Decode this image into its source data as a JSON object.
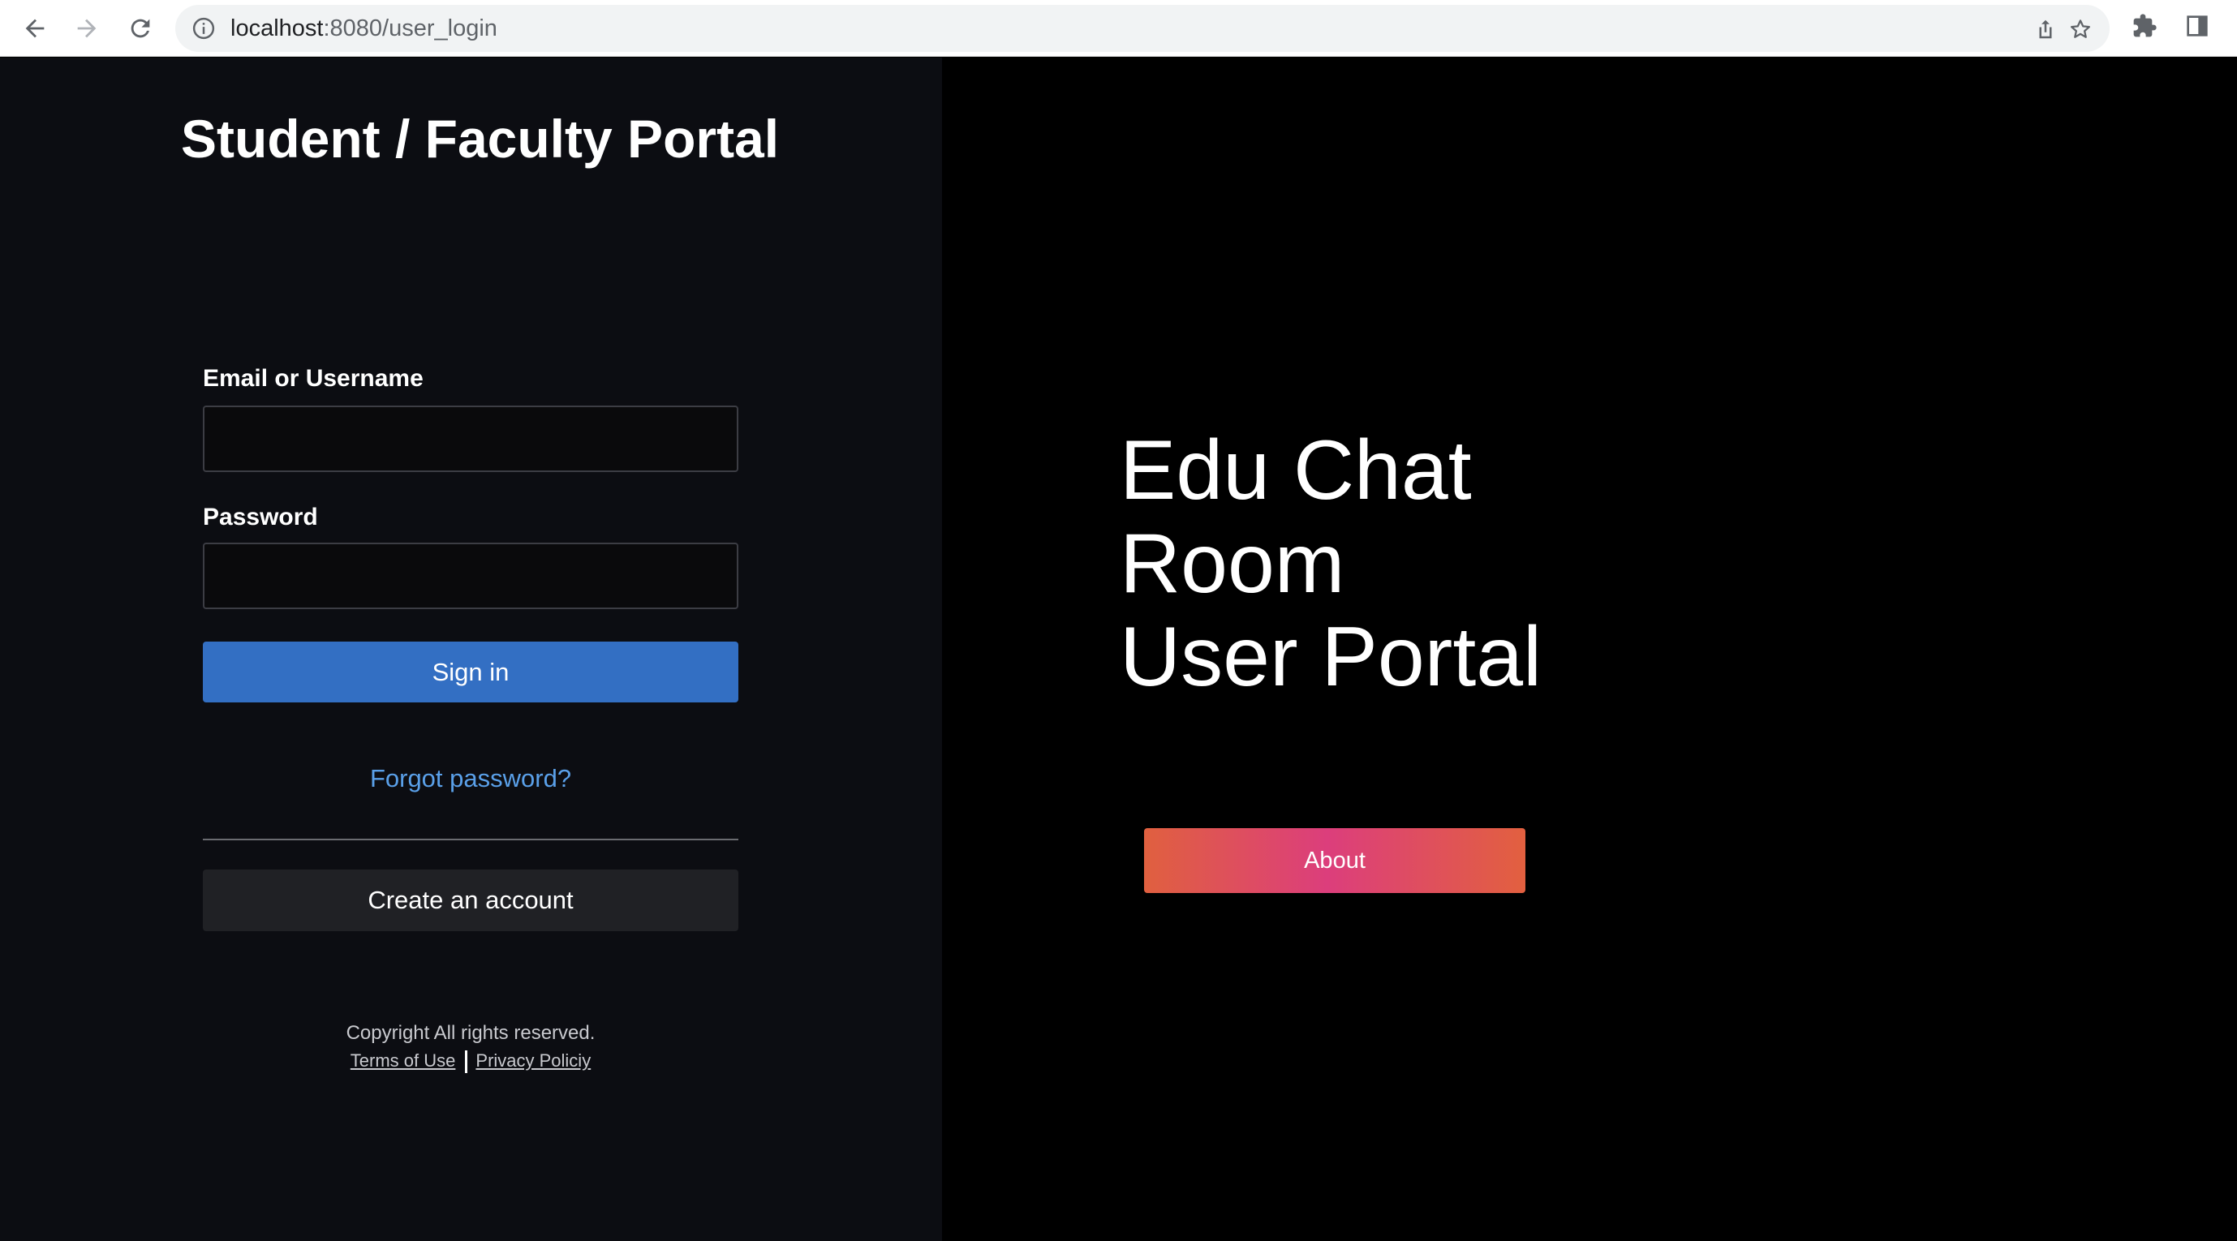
{
  "browser": {
    "url_host": "localhost",
    "url_path": ":8080/user_login"
  },
  "login": {
    "portal_title": "Student / Faculty Portal",
    "email_label": "Email or Username",
    "email_value": "",
    "password_label": "Password",
    "password_value": "",
    "signin_label": "Sign in",
    "forgot_label": "Forgot password?",
    "create_label": "Create an account"
  },
  "footer": {
    "copyright": "Copyright All rights reserved.",
    "terms_label": "Terms of Use",
    "privacy_label": "Privacy Policiy"
  },
  "hero": {
    "line1": "Edu Chat",
    "line2": "Room",
    "line3": "User Portal",
    "about_label": "About"
  },
  "colors": {
    "signin_bg": "#336fc3",
    "link": "#5aa0e9",
    "about_gradient_start": "#e0603f",
    "about_gradient_mid": "#dc3e7c"
  },
  "icons": {
    "back": "arrow-left",
    "forward": "arrow-right",
    "reload": "refresh",
    "site_info": "info-circle",
    "share": "share",
    "bookmark": "star",
    "extensions": "puzzle",
    "side_panel": "side-panel"
  }
}
